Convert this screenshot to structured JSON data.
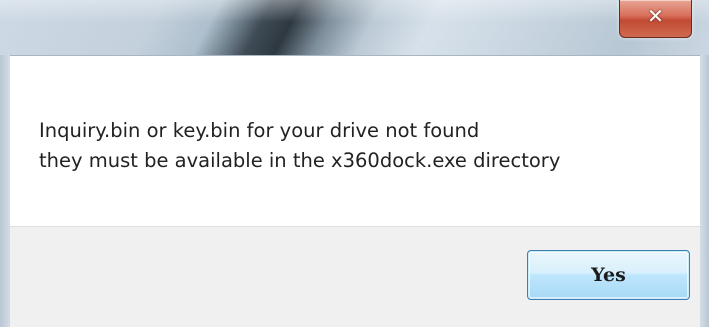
{
  "titlebar": {
    "close_glyph": "✕"
  },
  "message": {
    "line1": "Inquiry.bin or key.bin for your drive not found",
    "line2": "they must be available in the x360dock.exe directory"
  },
  "buttons": {
    "yes_label": "Yes"
  },
  "colors": {
    "close_button": "#c24a33",
    "button_accent": "#3c7fb1",
    "footer_bg": "#f0f0f0"
  }
}
